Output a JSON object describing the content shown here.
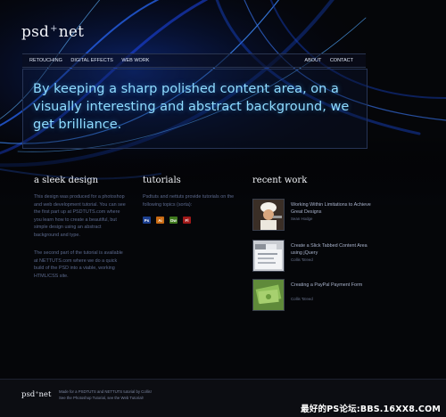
{
  "header": {
    "logo_left": "psd",
    "logo_plus": "+",
    "logo_right": "net"
  },
  "nav": {
    "left": [
      "RETOUCHING",
      "DIGITAL EFFECTS",
      "WEB WORK"
    ],
    "right": [
      "ABOUT",
      "CONTACT"
    ]
  },
  "hero": {
    "text": "By keeping a sharp polished content area, on a visually interesting and abstract background, we get brilliance."
  },
  "sleek": {
    "title": "a sleek design",
    "p1": "This design was produced for a photoshop and web development tutorial.  You can see the first part up at PSDTUTS.com where you learn how to create a beautiful, but simple design using an abstract background and type.",
    "p2": "The second part of the tutorial is available at NETTUTS.com where we do a quick build of the PSD into a viable, working HTML/CSS site."
  },
  "tutorials": {
    "title": "tutorials",
    "text": "Psdtuts and nettuts provide tutorials on the following topics (sorta):",
    "icons": [
      {
        "label": "Ps",
        "color": "#1c3f8f"
      },
      {
        "label": "Ai",
        "color": "#c96a12"
      },
      {
        "label": "Dw",
        "color": "#3f7a1e"
      },
      {
        "label": "Fl",
        "color": "#a01818"
      }
    ]
  },
  "recent": {
    "title": "recent work",
    "items": [
      {
        "title": "Working Within Limitations to Achieve Great Designs",
        "author": "Sean Hodge"
      },
      {
        "title": "Create a Slick Tabbed Content Area using jQuery",
        "author": "Collis Ta'eed"
      },
      {
        "title": "Creating a PayPal Payment Form",
        "author": "Collis Ta'eed"
      }
    ]
  },
  "footer": {
    "logo_left": "psd",
    "logo_plus": "+",
    "logo_right": "net",
    "line1": "Made for a PSDTUTS and NETTUTS tutorial by Collis!",
    "line2": "See the Photoshop Tutorial, see the Web Tutorial!"
  },
  "watermark": "最好的PS论坛:BBS.16XX8.COM",
  "colors": {
    "background": "#06070b",
    "hero_text": "#8fdcff",
    "accent_blue": "#1d4bff"
  }
}
